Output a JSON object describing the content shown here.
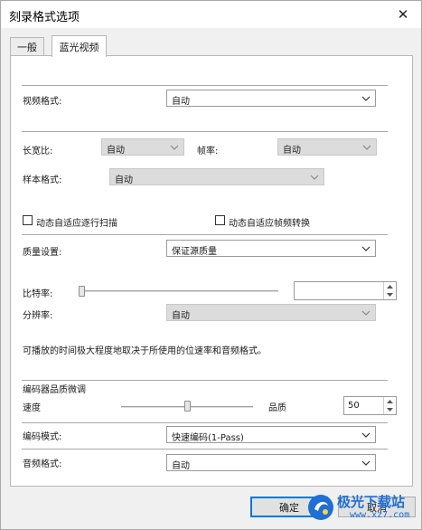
{
  "window": {
    "title": "刻录格式选项"
  },
  "tabs": [
    {
      "label": "一般"
    },
    {
      "label": "蓝光视频"
    }
  ],
  "video_format": {
    "label": "视频格式:",
    "value": "自动"
  },
  "aspect_ratio": {
    "label": "长宽比:",
    "value": "自动"
  },
  "frame_rate": {
    "label": "帧率:",
    "value": "自动"
  },
  "sample_format": {
    "label": "样本格式:",
    "value": "自动"
  },
  "adaptive_progressive": {
    "label": "动态自适应逐行扫描",
    "checked": false
  },
  "adaptive_framerate": {
    "label": "动态自适应帧频转换",
    "checked": false
  },
  "quality": {
    "label": "质量设置:",
    "value": "保证源质量"
  },
  "bitrate": {
    "label": "比特率:",
    "level": 0.0,
    "value": ""
  },
  "resolution": {
    "label": "分辨率:",
    "value": "自动"
  },
  "info_text": "可播放的时间极大程度地取决于所使用的位速率和音频格式。",
  "encoder": {
    "title": "编码器品质微调",
    "speed_label": "速度",
    "quality_label": "品质",
    "quality_value": "50",
    "slider_level": 0.5
  },
  "encode_mode": {
    "label": "编码模式:",
    "value": "快速编码(1-Pass)"
  },
  "audio_format": {
    "label": "音频格式:",
    "value": "自动"
  },
  "buttons": {
    "ok": "确定",
    "cancel": "取消"
  },
  "watermark": {
    "text": "极光下载站",
    "url": "www.xz7.com"
  },
  "colors": {
    "accent": "#0078d7",
    "watermark": "#1f6fd6"
  }
}
